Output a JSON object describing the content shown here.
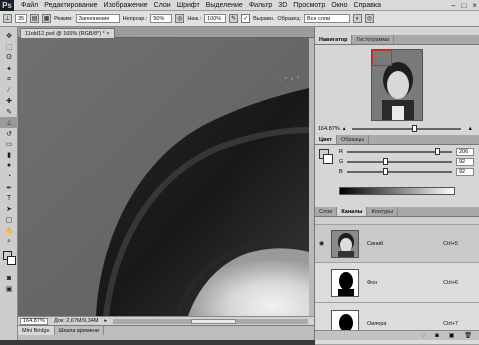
{
  "app": {
    "logo": "Ps"
  },
  "menu": [
    "Файл",
    "Редактирование",
    "Изображение",
    "Слои",
    "Шрифт",
    "Выделение",
    "Фильтр",
    "3D",
    "Просмотр",
    "Окно",
    "Справка"
  ],
  "window_controls": [
    "–",
    "□",
    "×"
  ],
  "options": {
    "size": "35",
    "mode_label": "Режим:",
    "mode_value": "Заполнение",
    "pressure_label": "Непрозр.:",
    "pressure_value": "50%",
    "flow_label": "Наж.:",
    "flow_value": "100%",
    "align_label": "Выравн.",
    "sample_label": "Образец:",
    "sample_value": "Все слои"
  },
  "document": {
    "tab_title": "11old12.psd @ 165% (RGB/8*) *"
  },
  "status": {
    "zoom": "164.87%",
    "doc": "Док: 2,67М/9,34М"
  },
  "bottom_tabs": [
    "Mini Bridge",
    "Шкала времени"
  ],
  "navigator": {
    "tabs": [
      "Навигатор",
      "Гистограмма"
    ],
    "zoom": "164.87%"
  },
  "color_panel": {
    "tabs": [
      "Цвет",
      "Образцы"
    ],
    "rows": [
      {
        "label": "R",
        "value": "206"
      },
      {
        "label": "G",
        "value": "92"
      },
      {
        "label": "B",
        "value": "92"
      }
    ],
    "levels": [
      0.86,
      0.36,
      0.36
    ]
  },
  "layers_panel": {
    "tabs": [
      "Слои",
      "Каналы",
      "Контуры"
    ],
    "channels": [
      {
        "name": "Синий",
        "shortcut": "Ctrl+5"
      },
      {
        "name": "Фон",
        "shortcut": "Ctrl+6"
      },
      {
        "name": "Овлера",
        "shortcut": "Ctrl+7"
      }
    ]
  },
  "tools": [
    "move-icon",
    "marquee-icon",
    "lasso-icon",
    "magic-wand-icon",
    "crop-icon",
    "eyedropper-icon",
    "healing-icon",
    "brush-icon",
    "stamp-icon",
    "history-brush-icon",
    "eraser-icon",
    "gradient-icon",
    "blur-icon",
    "dodge-icon",
    "pen-icon",
    "text-icon",
    "path-select-icon",
    "shape-icon",
    "hand-icon",
    "zoom-icon"
  ]
}
